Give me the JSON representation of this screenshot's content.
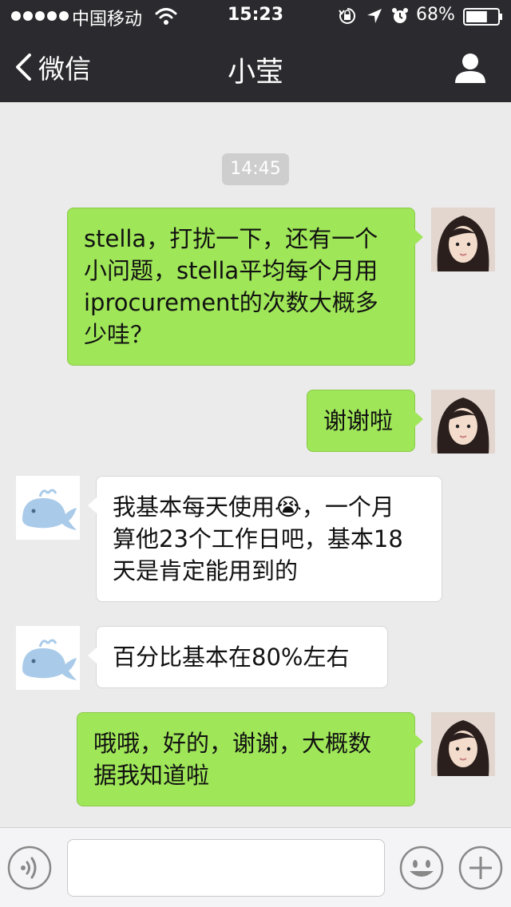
{
  "status_bar": {
    "carrier": "中国移动",
    "time": "15:23",
    "battery": "68%",
    "battery_level": 0.68,
    "signal_dots": 5
  },
  "nav": {
    "back_label": "微信",
    "title": "小莹"
  },
  "chat": {
    "timestamp": "14:45",
    "messages": [
      {
        "side": "right",
        "lines": [
          "stella，打扰一下，还有一个",
          "小问题，stella平均每个月用",
          "iprocurement的次数大概多",
          "少哇？"
        ]
      },
      {
        "side": "right",
        "lines": [
          "谢谢啦"
        ]
      },
      {
        "side": "left",
        "lines": [
          "我基本每天使用😭，一个月",
          "算他23个工作日吧，基本18",
          "天是肯定能用到的"
        ]
      },
      {
        "side": "left",
        "lines": [
          "百分比基本在80%左右"
        ]
      },
      {
        "side": "right",
        "lines": [
          "哦哦，好的，谢谢，大概数",
          "据我知道啦"
        ]
      }
    ]
  },
  "input_bar": {
    "value": "",
    "placeholder": ""
  },
  "colors": {
    "header_bg": "#2b2b2f",
    "chat_bg": "#ebebeb",
    "outgoing_bubble": "#9fe658",
    "incoming_bubble": "#ffffff",
    "timestamp_pill": "#cecece"
  },
  "icons": {
    "wifi": "wifi-icon",
    "lock": "rotation-lock-icon",
    "location": "location-arrow-icon",
    "alarm": "alarm-icon",
    "battery": "battery-icon",
    "back": "chevron-left-icon",
    "profile": "person-icon",
    "voice": "voice-icon",
    "emoji": "smiley-icon",
    "plus": "plus-icon"
  }
}
